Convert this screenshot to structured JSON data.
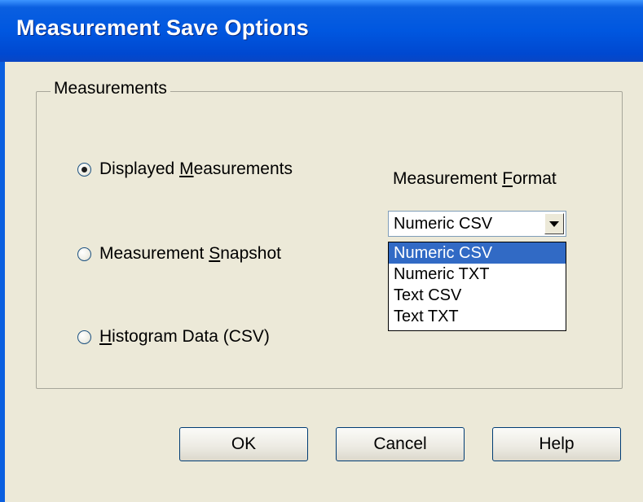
{
  "window": {
    "title": "Measurement Save Options"
  },
  "group": {
    "label": "Measurements"
  },
  "radios": [
    {
      "pre": "Displayed ",
      "mnemonic": "M",
      "post": "easurements",
      "selected": true
    },
    {
      "pre": "Measurement ",
      "mnemonic": "S",
      "post": "napshot",
      "selected": false
    },
    {
      "pre": "",
      "mnemonic": "H",
      "post": "istogram Data (CSV)",
      "selected": false
    }
  ],
  "format": {
    "label_pre": "Measurement ",
    "label_mnemonic": "F",
    "label_post": "ormat",
    "value": "Numeric CSV",
    "options": [
      "Numeric CSV",
      "Numeric TXT",
      "Text CSV",
      "Text TXT"
    ],
    "highlighted_index": 0
  },
  "buttons": {
    "ok": "OK",
    "cancel": "Cancel",
    "help": "Help"
  },
  "colors": {
    "titlebar": "#0057e0",
    "selection": "#316ac5",
    "dialog_bg": "#ece9d8"
  }
}
